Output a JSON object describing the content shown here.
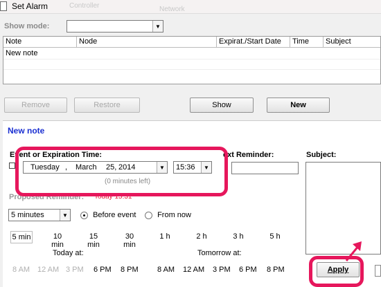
{
  "window": {
    "title": "Set Alarm",
    "ghost_texts": [
      "Controller",
      "Network"
    ]
  },
  "filter": {
    "label": "Show mode:",
    "value": ""
  },
  "grid": {
    "columns": [
      "Note",
      "Node",
      "Expirat./Start Date",
      "Time",
      "Subject"
    ],
    "rows": [
      {
        "note": "New note"
      }
    ]
  },
  "buttons": {
    "remove": "Remove",
    "restore": "Restore",
    "show": "Show",
    "new": "New",
    "apply": "Apply"
  },
  "editor": {
    "heading": "New note",
    "event_label": "Event or Expiration Time:",
    "date": {
      "weekday": "Tuesday",
      "month": "March",
      "day": "25,",
      "year": "2014"
    },
    "time_value": "15:36",
    "minutes_left": "(0 minutes left)",
    "next_reminder_label": "Next Reminder:",
    "next_reminder_label_visible": "ext Reminder:",
    "subject_label": "Subject:",
    "proposed_label": "Proposed Reminder:",
    "proposed_value": "Today 15:31",
    "interval_value": "5 minutes",
    "radio_before": "Before event",
    "radio_from_now": "From now"
  },
  "durations": [
    "5 min",
    "10 min",
    "15 min",
    "30 min",
    "1 h",
    "2 h",
    "3 h",
    "5 h"
  ],
  "today_label": "Today at:",
  "tomorrow_label": "Tomorrow at:",
  "today_times": [
    "8 AM",
    "12 AM",
    "3 PM",
    "6 PM",
    "8 PM"
  ],
  "tomorrow_times": [
    "8 AM",
    "12 AM",
    "3 PM",
    "6 PM",
    "8 PM"
  ],
  "colors": {
    "accent_highlight": "#e6175c",
    "heading_blue": "#1a2fd1",
    "proposed_red": "#e8102e"
  }
}
